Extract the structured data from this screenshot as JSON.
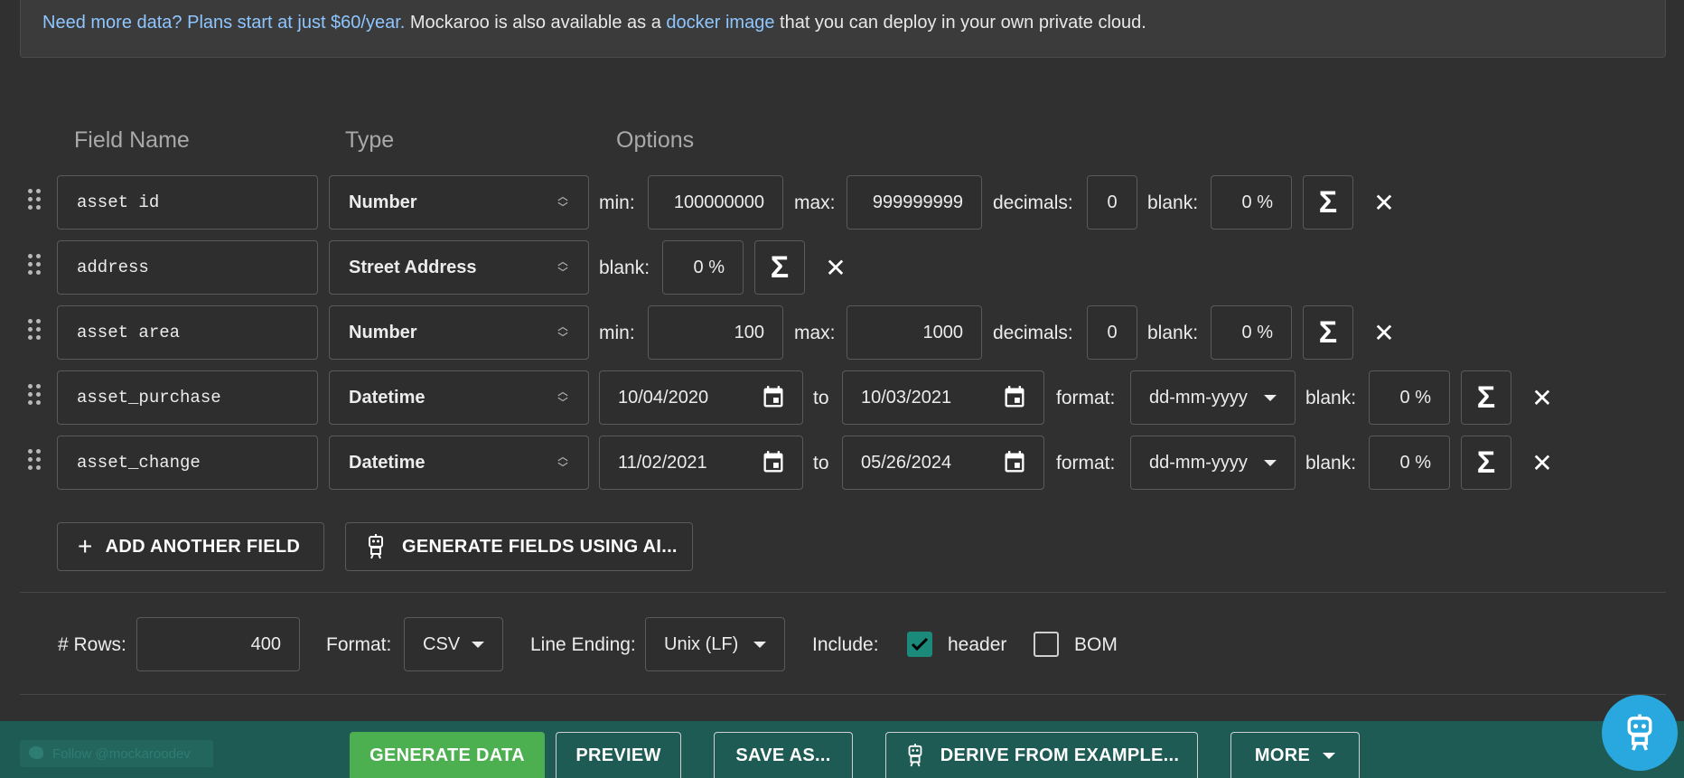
{
  "banner": {
    "link1": "Need more data? Plans start at just $60/year.",
    "text1": " Mockaroo is also available as a ",
    "link2": "docker image",
    "text2": " that you can deploy in your own private cloud."
  },
  "columns": {
    "field_name": "Field Name",
    "type": "Type",
    "options": "Options"
  },
  "fields": [
    {
      "name": "asset id",
      "type": "Number",
      "min_label": "min:",
      "min": "100000000",
      "max_label": "max:",
      "max": "999999999",
      "decimals_label": "decimals:",
      "decimals": "0",
      "blank_label": "blank:",
      "blank": "0 %"
    },
    {
      "name": "address",
      "type": "Street Address",
      "blank_label": "blank:",
      "blank": "0 %"
    },
    {
      "name": "asset area",
      "type": "Number",
      "min_label": "min:",
      "min": "100",
      "max_label": "max:",
      "max": "1000",
      "decimals_label": "decimals:",
      "decimals": "0",
      "blank_label": "blank:",
      "blank": "0 %"
    },
    {
      "name": "asset_purchase",
      "type": "Datetime",
      "from": "10/04/2020",
      "to_label": "to",
      "to": "10/03/2021",
      "format_label": "format:",
      "format": "dd-mm-yyyy",
      "blank_label": "blank:",
      "blank": "0 %"
    },
    {
      "name": "asset_change",
      "type": "Datetime",
      "from": "11/02/2021",
      "to_label": "to",
      "to": "05/26/2024",
      "format_label": "format:",
      "format": "dd-mm-yyyy",
      "blank_label": "blank:",
      "blank": "0 %"
    }
  ],
  "icons": {
    "sigma": "Σ",
    "remove": "✕"
  },
  "actions": {
    "add_field": "ADD ANOTHER FIELD",
    "ai_fields": "GENERATE FIELDS USING AI..."
  },
  "settings": {
    "rows_label": "# Rows:",
    "rows": "400",
    "format_label": "Format:",
    "format": "CSV",
    "line_ending_label": "Line Ending:",
    "line_ending": "Unix (LF)",
    "include_label": "Include:",
    "header_label": "header",
    "header_checked": true,
    "bom_label": "BOM",
    "bom_checked": false
  },
  "footer": {
    "follow": "Follow @mockaroodev",
    "generate": "GENERATE DATA",
    "preview": "PREVIEW",
    "save_as": "SAVE AS...",
    "derive": "DERIVE FROM EXAMPLE...",
    "more": "MORE"
  },
  "colors": {
    "accent_green": "#4caf50",
    "footer_teal": "#1e5b54",
    "checkbox_teal": "#1b8a7a",
    "link_blue": "#8ec6ff",
    "bot_blue": "#29a8df"
  }
}
